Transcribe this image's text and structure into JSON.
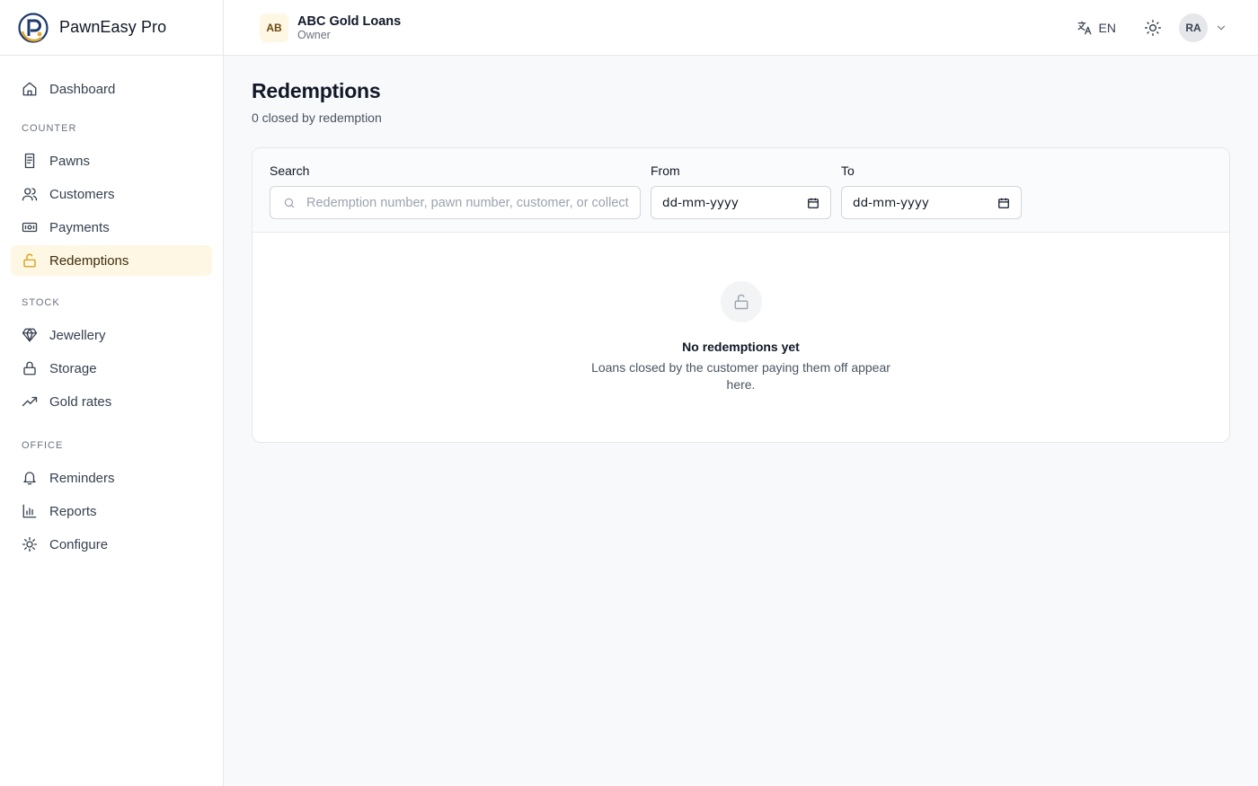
{
  "app": {
    "name": "PawnEasy Pro"
  },
  "header": {
    "org_initials": "AB",
    "org_name": "ABC Gold Loans",
    "org_role": "Owner",
    "language": "EN",
    "user_initials": "RA"
  },
  "sidebar": {
    "dashboard": "Dashboard",
    "sections": {
      "counter": "COUNTER",
      "stock": "STOCK",
      "office": "OFFICE"
    },
    "counter_items": [
      {
        "label": "Pawns",
        "icon": "receipt-icon"
      },
      {
        "label": "Customers",
        "icon": "users-icon"
      },
      {
        "label": "Payments",
        "icon": "banknote-icon"
      },
      {
        "label": "Redemptions",
        "icon": "unlock-icon",
        "active": true
      }
    ],
    "stock_items": [
      {
        "label": "Jewellery",
        "icon": "gem-icon"
      },
      {
        "label": "Storage",
        "icon": "lock-icon"
      },
      {
        "label": "Gold rates",
        "icon": "trending-up-icon"
      }
    ],
    "office_items": [
      {
        "label": "Reminders",
        "icon": "bell-icon"
      },
      {
        "label": "Reports",
        "icon": "bar-chart-icon"
      },
      {
        "label": "Configure",
        "icon": "sun-gear-icon"
      }
    ]
  },
  "page": {
    "title": "Redemptions",
    "subtitle": "0 closed by redemption"
  },
  "filters": {
    "search_label": "Search",
    "search_placeholder": "Redemption number, pawn number, customer, or collect",
    "from_label": "From",
    "from_value": "dd-mm-yyyy",
    "to_label": "To",
    "to_value": "dd-mm-yyyy"
  },
  "empty_state": {
    "title": "No redemptions yet",
    "description": "Loans closed by the customer paying them off appear here."
  },
  "colors": {
    "accent": "#d4a017",
    "active_bg": "#fef7e4",
    "border": "#e5e7eb"
  }
}
